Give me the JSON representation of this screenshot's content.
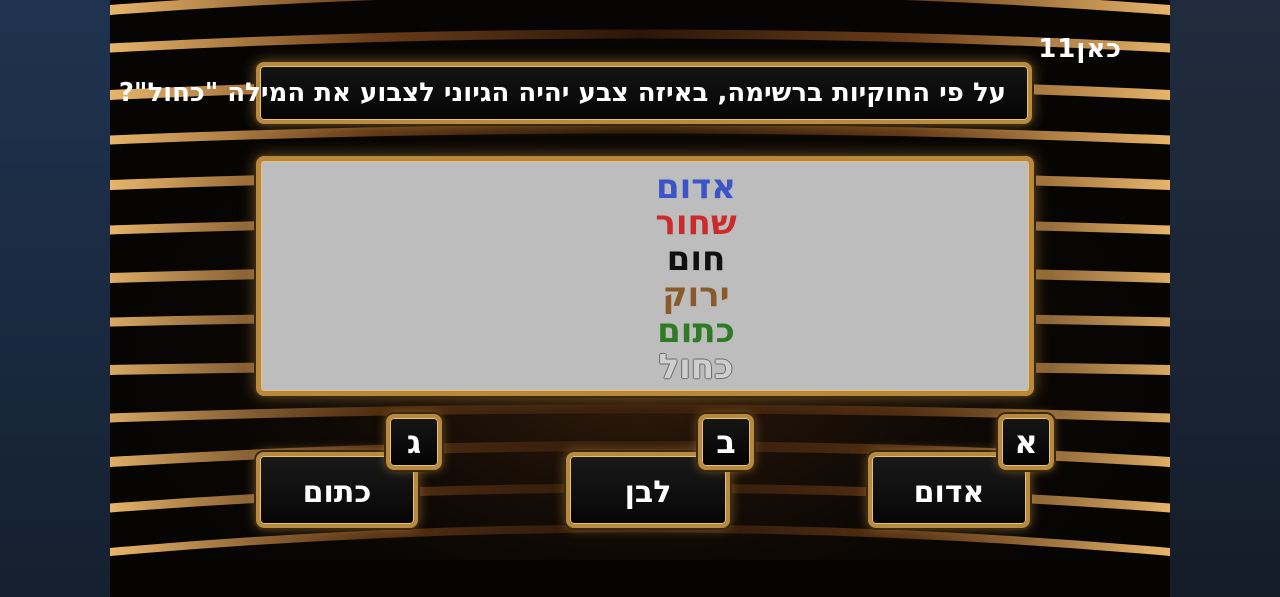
{
  "channel_logo": "כאן11",
  "question": "על פי החוקיות ברשימה, באיזה צבע יהיה הגיוני לצבוע את המילה \"כחול\"?",
  "word_list": [
    {
      "text": "אדום",
      "color": "#3d54c8"
    },
    {
      "text": "שחור",
      "color": "#cc2b2b"
    },
    {
      "text": "חום",
      "color": "#101010"
    },
    {
      "text": "ירוק",
      "color": "#8a5a2a"
    },
    {
      "text": "כתום",
      "color": "#2f7a25"
    },
    {
      "text": "כחול",
      "color": "#cfcfcf",
      "style": "outlined"
    }
  ],
  "answers": [
    {
      "letter": "א",
      "label": "אדום"
    },
    {
      "letter": "ב",
      "label": "לבן"
    },
    {
      "letter": "ג",
      "label": "כתום"
    }
  ],
  "colors": {
    "gold_frame": "#b78a3e",
    "panel_bg": "#bdbdbd",
    "box_bg": "#0a0a0a"
  }
}
